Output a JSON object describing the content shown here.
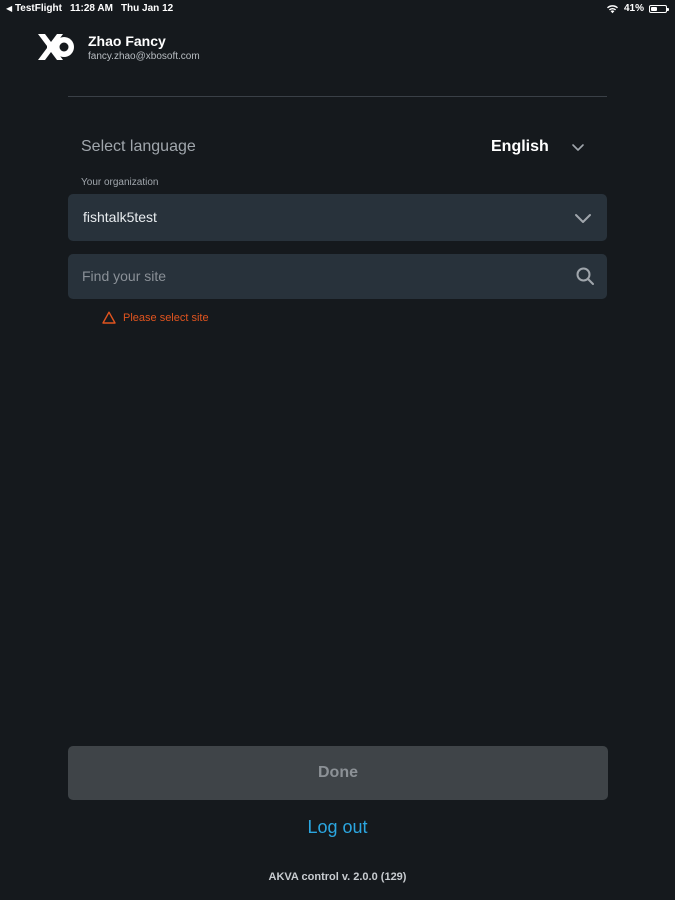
{
  "status_bar": {
    "back_app": "TestFlight",
    "time": "11:28 AM",
    "date": "Thu Jan 12",
    "battery_percent": "41%",
    "battery_level": 0.41,
    "icons": [
      "back-arrow-icon",
      "wifi-icon",
      "battery-icon"
    ]
  },
  "header": {
    "logo_icon": "akva-logo-icon",
    "user_name": "Zhao Fancy",
    "user_email": "fancy.zhao@xbosoft.com"
  },
  "language": {
    "label": "Select language",
    "value": "English",
    "icon": "chevron-down-icon"
  },
  "organization": {
    "label": "Your organization",
    "value": "fishtalk5test",
    "icon": "chevron-down-icon"
  },
  "site_search": {
    "placeholder": "Find your site",
    "value": "",
    "icon": "search-icon"
  },
  "error": {
    "message": "Please select site",
    "icon": "warning-icon",
    "color": "#e0541f"
  },
  "actions": {
    "done_label": "Done",
    "logout_label": "Log out"
  },
  "footer": {
    "version": "AKVA control v. 2.0.0 (129)"
  },
  "colors": {
    "background": "#15191d",
    "field_background": "#28323b",
    "accent": "#2ba6e0",
    "error": "#e0541f",
    "disabled_button": "#3f4448"
  }
}
